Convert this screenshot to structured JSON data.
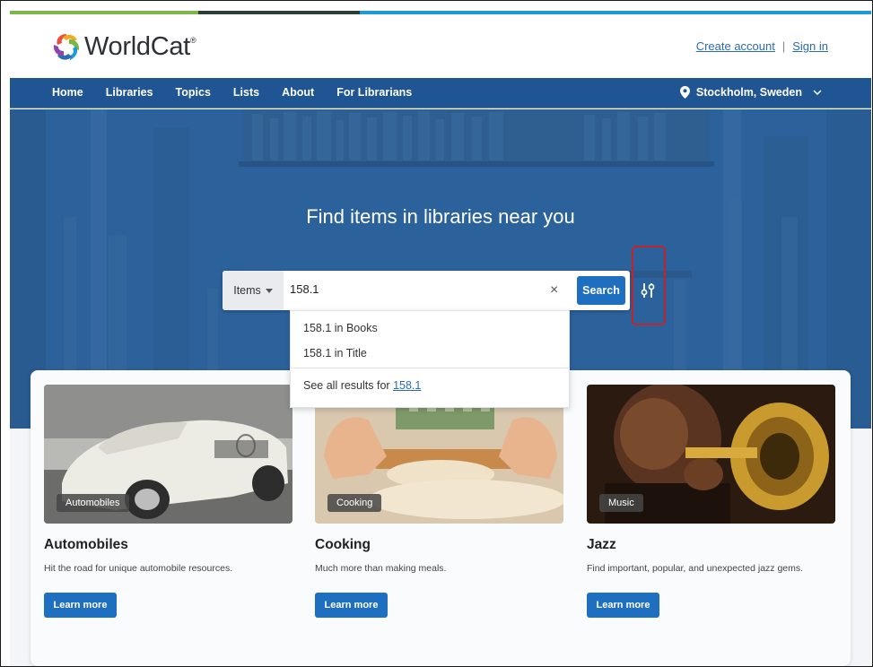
{
  "brand": {
    "name": "WorldCat",
    "mark": "®",
    "stripe_colors": [
      "#7ab648",
      "#2c3e3a",
      "#1d9bd8"
    ]
  },
  "account": {
    "create_label": "Create account",
    "separator": "|",
    "signin_label": "Sign in"
  },
  "nav": {
    "items": [
      {
        "label": "Home"
      },
      {
        "label": "Libraries"
      },
      {
        "label": "Topics"
      },
      {
        "label": "Lists"
      },
      {
        "label": "About"
      },
      {
        "label": "For Librarians"
      }
    ],
    "location_label": "Stockholm, Sweden",
    "location_icon": "map-pin-icon"
  },
  "hero": {
    "title": "Find items in libraries near you"
  },
  "search": {
    "scope_label": "Items",
    "query": "158.1",
    "button_label": "Search",
    "clear_icon": "×",
    "advanced_icon": "sliders-icon",
    "suggestions": [
      {
        "label": "158.1 in Books"
      },
      {
        "label": "158.1 in Title"
      }
    ],
    "see_all_prefix": "See all results for",
    "see_all_link": "158.1"
  },
  "cards": [
    {
      "badge": "Automobiles",
      "title": "Automobiles",
      "desc": "Hit the road for unique automobile resources.",
      "button": "Learn more"
    },
    {
      "badge": "Cooking",
      "title": "Cooking",
      "desc": "Much more than making meals.",
      "button": "Learn more"
    },
    {
      "badge": "Music",
      "title": "Jazz",
      "desc": "Find important, popular, and unexpected jazz gems.",
      "button": "Learn more"
    }
  ],
  "colors": {
    "nav_bg": "#1f5592",
    "accent_button": "#1f6fc0",
    "link": "#2a6bb5",
    "highlight_box": "#c3232b"
  }
}
